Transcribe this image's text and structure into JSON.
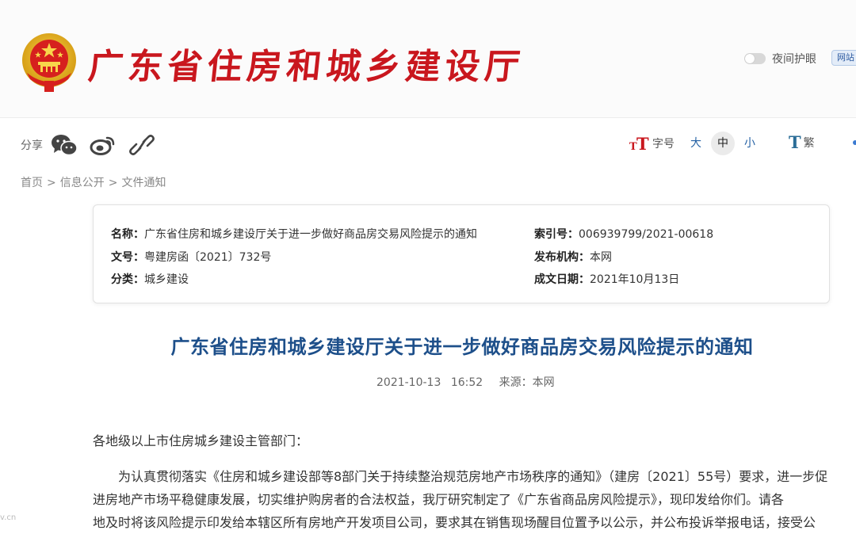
{
  "header": {
    "site_name": "广东省住房和城乡建设厅",
    "night_mode_label": "夜间护眼",
    "site_button_label": "网站",
    "colors": {
      "brand_red": "#c9171e",
      "title_blue": "#1d4f8a"
    }
  },
  "share": {
    "label": "分享",
    "icons": [
      "wechat-icon",
      "weibo-icon",
      "link-icon"
    ]
  },
  "tools": {
    "font_size_label": "字号",
    "sizes": [
      "大",
      "中",
      "小"
    ],
    "active_size": "中",
    "traditional_label": "繁"
  },
  "breadcrumb": {
    "items": [
      "首页",
      "信息公开",
      "文件通知"
    ],
    "separator": ">"
  },
  "meta": {
    "name_label": "名称：",
    "name_value": "广东省住房和城乡建设厅关于进一步做好商品房交易风险提示的通知",
    "doc_no_label": "文号：",
    "doc_no_value": "粤建房函〔2021〕732号",
    "category_label": "分类：",
    "category_value": "城乡建设",
    "index_label": "索引号：",
    "index_value": "006939799/2021-00618",
    "publisher_label": "发布机构：",
    "publisher_value": "本网",
    "date_label": "成文日期：",
    "date_value": "2021年10月13日"
  },
  "article": {
    "title": "广东省住房和城乡建设厅关于进一步做好商品房交易风险提示的通知",
    "date": "2021-10-13",
    "time": "16:52",
    "source": "来源：本网",
    "salutation": "各地级以上市住房城乡建设主管部门：",
    "paragraph_lines": [
      "为认真贯彻落实《住房和城乡建设部等8部门关于持续整治规范房地产市场秩序的通知》（建房〔2021〕55号）要求，进一步促",
      "进房地产市场平稳健康发展，切实维护购房者的合法权益，我厅研究制定了《广东省商品房风险提示》，现印发给你们。请各",
      "地及时将该风险提示印发给本辖区所有房地产开发项目公司，要求其在销售现场醒目位置予以公示，并公布投诉举报电话，接受公"
    ]
  },
  "watermark": "v.cn"
}
